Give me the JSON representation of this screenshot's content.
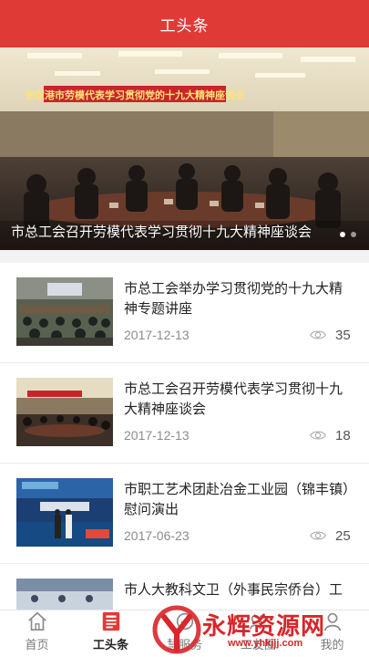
{
  "header": {
    "title": "工头条"
  },
  "banner": {
    "caption": "市总工会召开劳模代表学习贯彻十九大精神座谈会",
    "backdrop_text": "张家港市劳模代表学习贯彻党的十九大精神座谈会",
    "slides": 2,
    "active_slide": 1
  },
  "news": [
    {
      "title": "市总工会举办学习贯彻党的十九大精神专题讲座",
      "date": "2017-12-13",
      "views": "35"
    },
    {
      "title": "市总工会召开劳模代表学习贯彻十九大精神座谈会",
      "date": "2017-12-13",
      "views": "18"
    },
    {
      "title": "市职工艺术团赴冶金工业园（锦丰镇）慰问演出",
      "date": "2017-06-23",
      "views": "25"
    },
    {
      "title": "市人大教科文卫（外事民宗侨台）工",
      "date": "",
      "views": ""
    }
  ],
  "tabbar": {
    "tabs": [
      {
        "label": "首页",
        "icon": "home-icon"
      },
      {
        "label": "工头条",
        "icon": "news-icon"
      },
      {
        "label": "慧服务",
        "icon": "service-icon"
      },
      {
        "label": "工友圈",
        "icon": "circle-icon"
      },
      {
        "label": "我的",
        "icon": "profile-icon"
      }
    ],
    "active": 1
  },
  "watermark": {
    "text": "永辉资源网",
    "url": "www.yhkjjj.com"
  },
  "colors": {
    "brand": "#e03a37",
    "watermark": "#d8262a"
  }
}
